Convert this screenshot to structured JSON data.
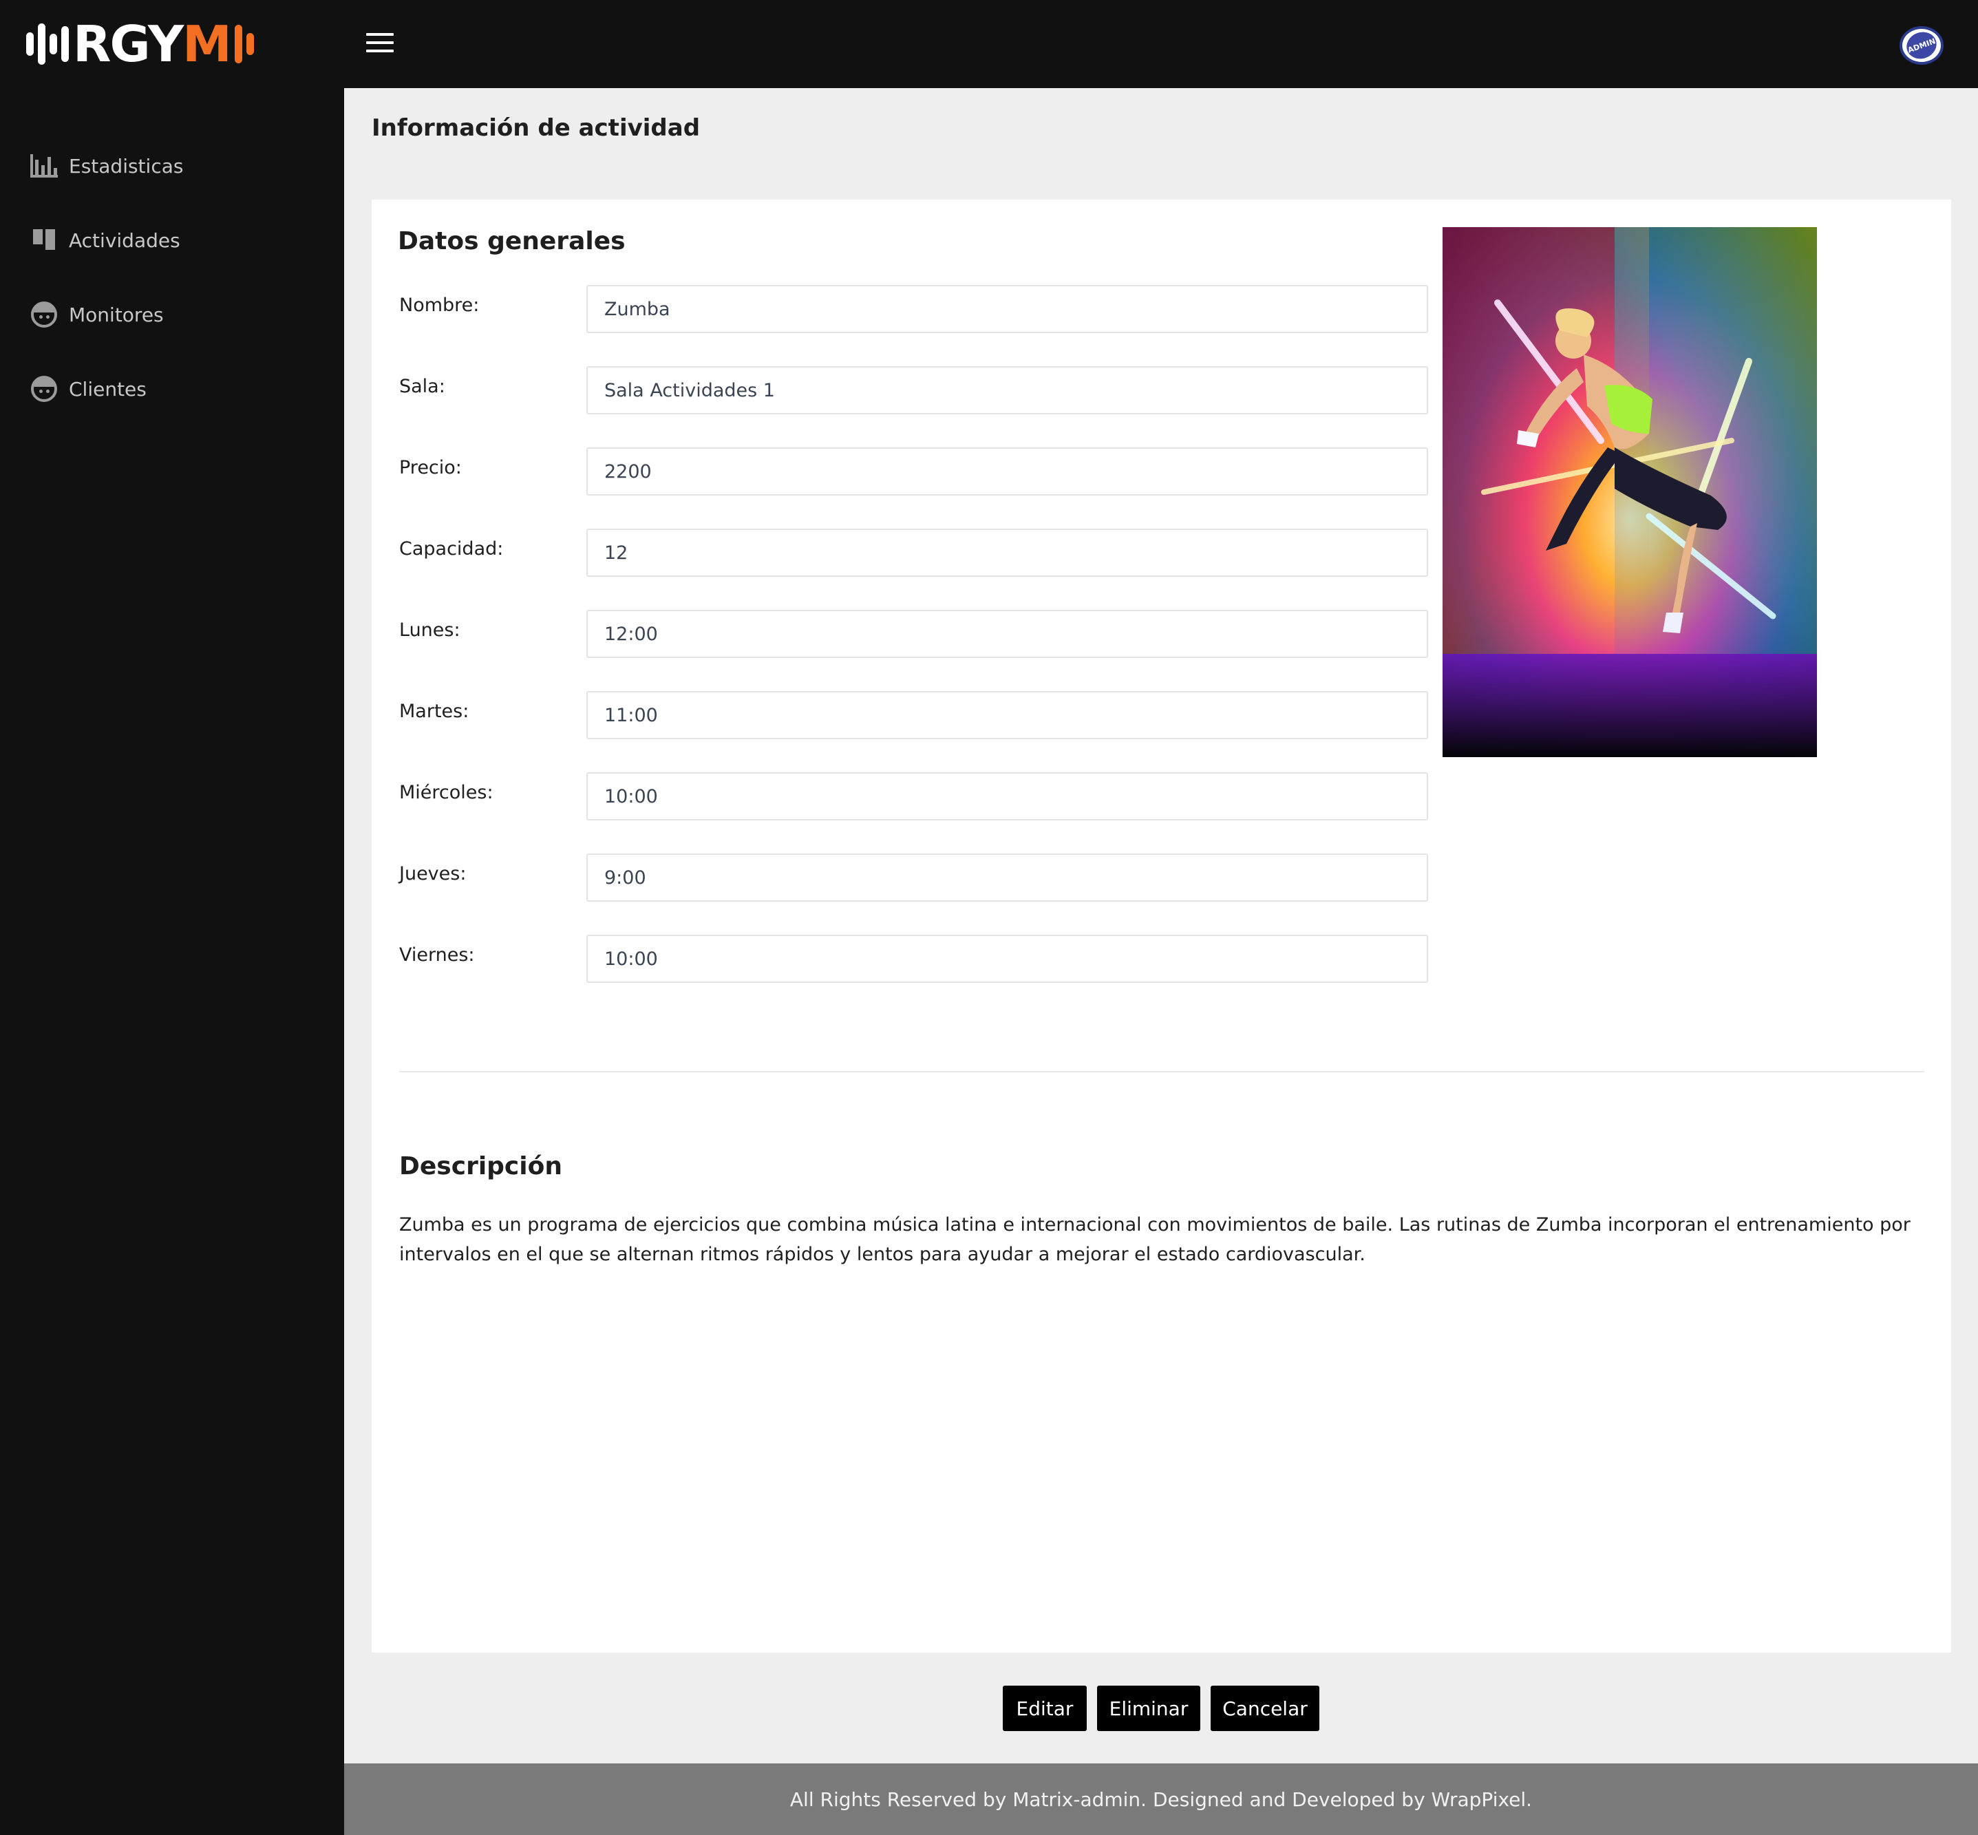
{
  "header": {
    "logo_text_white": "RGY",
    "logo_text_orange": "M",
    "menu_icon": "hamburger-icon",
    "avatar_text": "ADMIN",
    "brand_accent": "#f36f21"
  },
  "sidebar": {
    "items": [
      {
        "label": "Estadisticas",
        "icon": "bar-chart-icon"
      },
      {
        "label": "Actividades",
        "icon": "dashboard-icon"
      },
      {
        "label": "Monitores",
        "icon": "face-icon"
      },
      {
        "label": "Clientes",
        "icon": "face-icon"
      }
    ]
  },
  "page": {
    "title": "Información de actividad"
  },
  "general": {
    "title": "Datos generales",
    "fields": [
      {
        "label": "Nombre:",
        "value": "Zumba"
      },
      {
        "label": "Sala:",
        "value": "Sala Actividades 1"
      },
      {
        "label": "Precio:",
        "value": "2200"
      },
      {
        "label": "Capacidad:",
        "value": "12"
      },
      {
        "label": "Lunes:",
        "value": "12:00"
      },
      {
        "label": "Martes:",
        "value": "11:00"
      },
      {
        "label": "Miércoles:",
        "value": "10:00"
      },
      {
        "label": "Jueves:",
        "value": "9:00"
      },
      {
        "label": "Viernes:",
        "value": "10:00"
      }
    ]
  },
  "description": {
    "title": "Descripción",
    "text": "Zumba es un programa de ejercicios que combina música latina e internacional con movimientos de baile. Las rutinas de Zumba incorporan el entrenamiento por intervalos en el que se alternan ritmos rápidos y lentos para ayudar a mejorar el estado cardiovascular."
  },
  "actions": {
    "edit": "Editar",
    "delete": "Eliminar",
    "cancel": "Cancelar"
  },
  "footer": {
    "text": "All Rights Reserved by Matrix-admin. Designed and Developed by WrapPixel."
  }
}
